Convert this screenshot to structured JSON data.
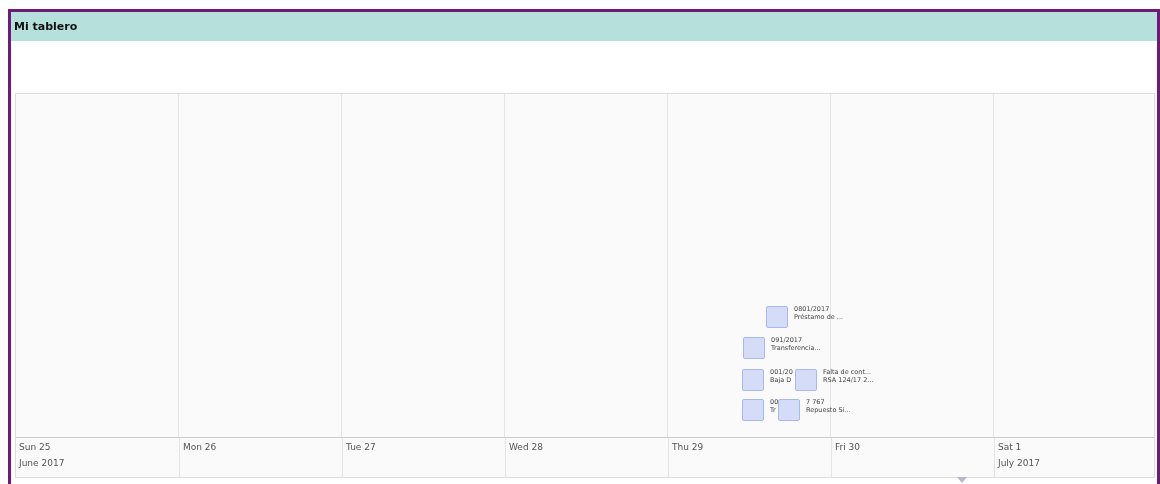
{
  "panel": {
    "title": "Mi tablero"
  },
  "timeline": {
    "days": [
      {
        "label": "Sun 25",
        "month": "June 2017"
      },
      {
        "label": "Mon 26"
      },
      {
        "label": "Tue 27"
      },
      {
        "label": "Wed 28"
      },
      {
        "label": "Thu 29"
      },
      {
        "label": "Fri 30"
      },
      {
        "label": "Sat 1",
        "month": "July 2017"
      }
    ],
    "events": [
      {
        "lines": [
          "0801/2017",
          "Préstamo de ..."
        ]
      },
      {
        "lines": [
          "091/2017",
          "Transferencia..."
        ]
      },
      {
        "lines": [
          "001/20",
          "Baja D"
        ]
      },
      {
        "lines": [
          "Falta de cont...",
          "RSA 124/17 2..."
        ]
      },
      {
        "lines": [
          "00",
          "Tr"
        ]
      },
      {
        "lines": [
          "7 767",
          "Repuesto Si..."
        ]
      }
    ]
  }
}
